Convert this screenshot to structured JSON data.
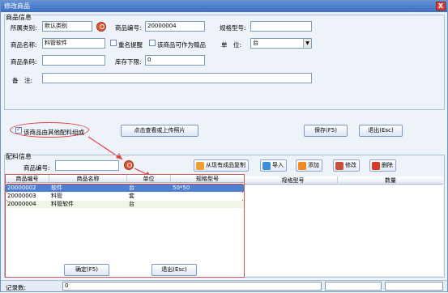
{
  "window": {
    "title": "修改商品",
    "close_label": "X"
  },
  "product": {
    "group_title": "商品信息",
    "category_label": "所属类别:",
    "category_value": "默认类别",
    "code_label": "商品编号:",
    "code_value": "20000004",
    "model_label": "规格型号:",
    "model_value": "",
    "name_label": "商品名称:",
    "name_value": "料管软件",
    "duplicate_label": "重名提醒",
    "gift_label": "该商品可作为赠品",
    "unit_label": "单　位:",
    "unit_value": "台",
    "barcode_label": "商品条码:",
    "barcode_value": "",
    "stock_label": "库存下限:",
    "stock_value": "0",
    "remark_label": "备　注:",
    "remark_value": ""
  },
  "actions": {
    "composite_label": "该商品由其他配料组成",
    "photo_button": "点击查看或上传照片",
    "save_button": "保存(F5)",
    "exit_button": "退出(Esc)"
  },
  "ingredients": {
    "group_title": "配料信息",
    "code_label": "商品编号:",
    "code_value": "",
    "copy_button": "从现有成品复制",
    "import_button": "导入",
    "add_button": "添加",
    "edit_button": "修改",
    "delete_button": "删除",
    "main_columns": [
      "规格型号",
      "数量"
    ]
  },
  "popup": {
    "columns": [
      "商品编号",
      "商品名称",
      "单位",
      "规格型号"
    ],
    "rows": [
      {
        "code": "20000002",
        "name": "软件",
        "unit": "台",
        "spec": "50*50"
      },
      {
        "code": "20000003",
        "name": "料管",
        "unit": "套",
        "spec": ""
      },
      {
        "code": "20000004",
        "name": "料管软件",
        "unit": "台",
        "spec": ""
      }
    ],
    "confirm_button": "确定(F5)",
    "exit_button": "退出(Esc)"
  },
  "status": {
    "count_label": "记录数:",
    "count_value": "0"
  },
  "colors": {
    "accent": "#3e6fc0",
    "highlight": "#e04040",
    "selected_row": "#4f7fd0"
  }
}
